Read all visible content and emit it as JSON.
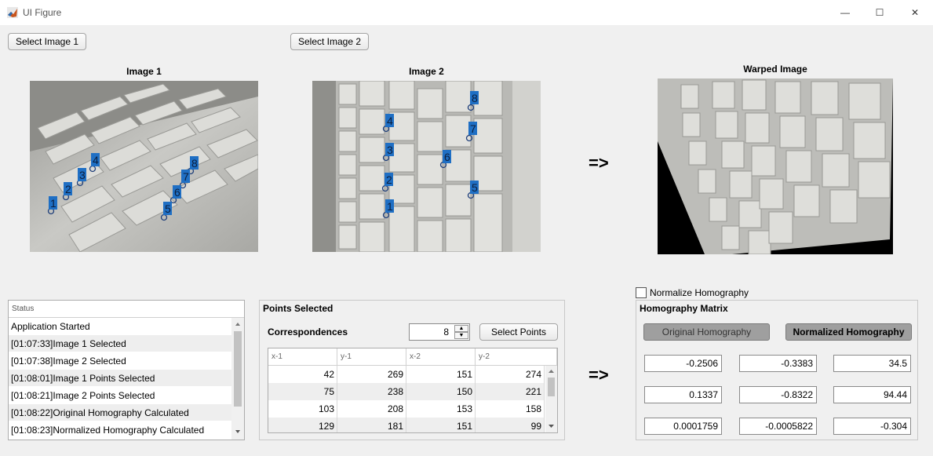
{
  "window": {
    "title": "UI Figure",
    "minimize_glyph": "—",
    "maximize_glyph": "☐",
    "close_glyph": "✕"
  },
  "buttons": {
    "select_image_1": "Select Image 1",
    "select_image_2": "Select Image 2",
    "select_points": "Select Points"
  },
  "images": {
    "image1_title": "Image 1",
    "image2_title": "Image 2",
    "warped_title": "Warped Image",
    "image1_points": [
      "1",
      "2",
      "3",
      "4",
      "5",
      "6",
      "7",
      "8"
    ],
    "image2_points": [
      "1",
      "2",
      "3",
      "4",
      "5",
      "6",
      "7",
      "8"
    ],
    "point_marker_color": "#1f6fc4"
  },
  "arrows": {
    "arrow1": "=>",
    "arrow2": "=>"
  },
  "status": {
    "header": "Status",
    "items": [
      "Application Started",
      "[01:07:33]Image 1 Selected",
      "[01:07:38]Image 2 Selected",
      "[01:08:01]Image 1 Points Selected",
      "[01:08:21]Image 2 Points Selected",
      "[01:08:22]Original Homography Calculated",
      "[01:08:23]Normalized Homography Calculated"
    ]
  },
  "points": {
    "title": "Points Selected",
    "correspondences_label": "Correspondences",
    "correspondences_value": "8",
    "columns": [
      "x-1",
      "y-1",
      "x-2",
      "y-2"
    ],
    "rows": [
      [
        "42",
        "269",
        "151",
        "274"
      ],
      [
        "75",
        "238",
        "150",
        "221"
      ],
      [
        "103",
        "208",
        "153",
        "158"
      ],
      [
        "129",
        "181",
        "151",
        "99"
      ]
    ]
  },
  "homography": {
    "normalize_label": "Normalize Homography",
    "normalize_checked": false,
    "title": "Homography Matrix",
    "original_button": "Original Homography",
    "normalized_button": "Normalized Homography",
    "matrix": [
      [
        "-0.2506",
        "-0.3383",
        "34.5"
      ],
      [
        "0.1337",
        "-0.8322",
        "94.44"
      ],
      [
        "0.0001759",
        "-0.0005822",
        "-0.304"
      ]
    ]
  }
}
